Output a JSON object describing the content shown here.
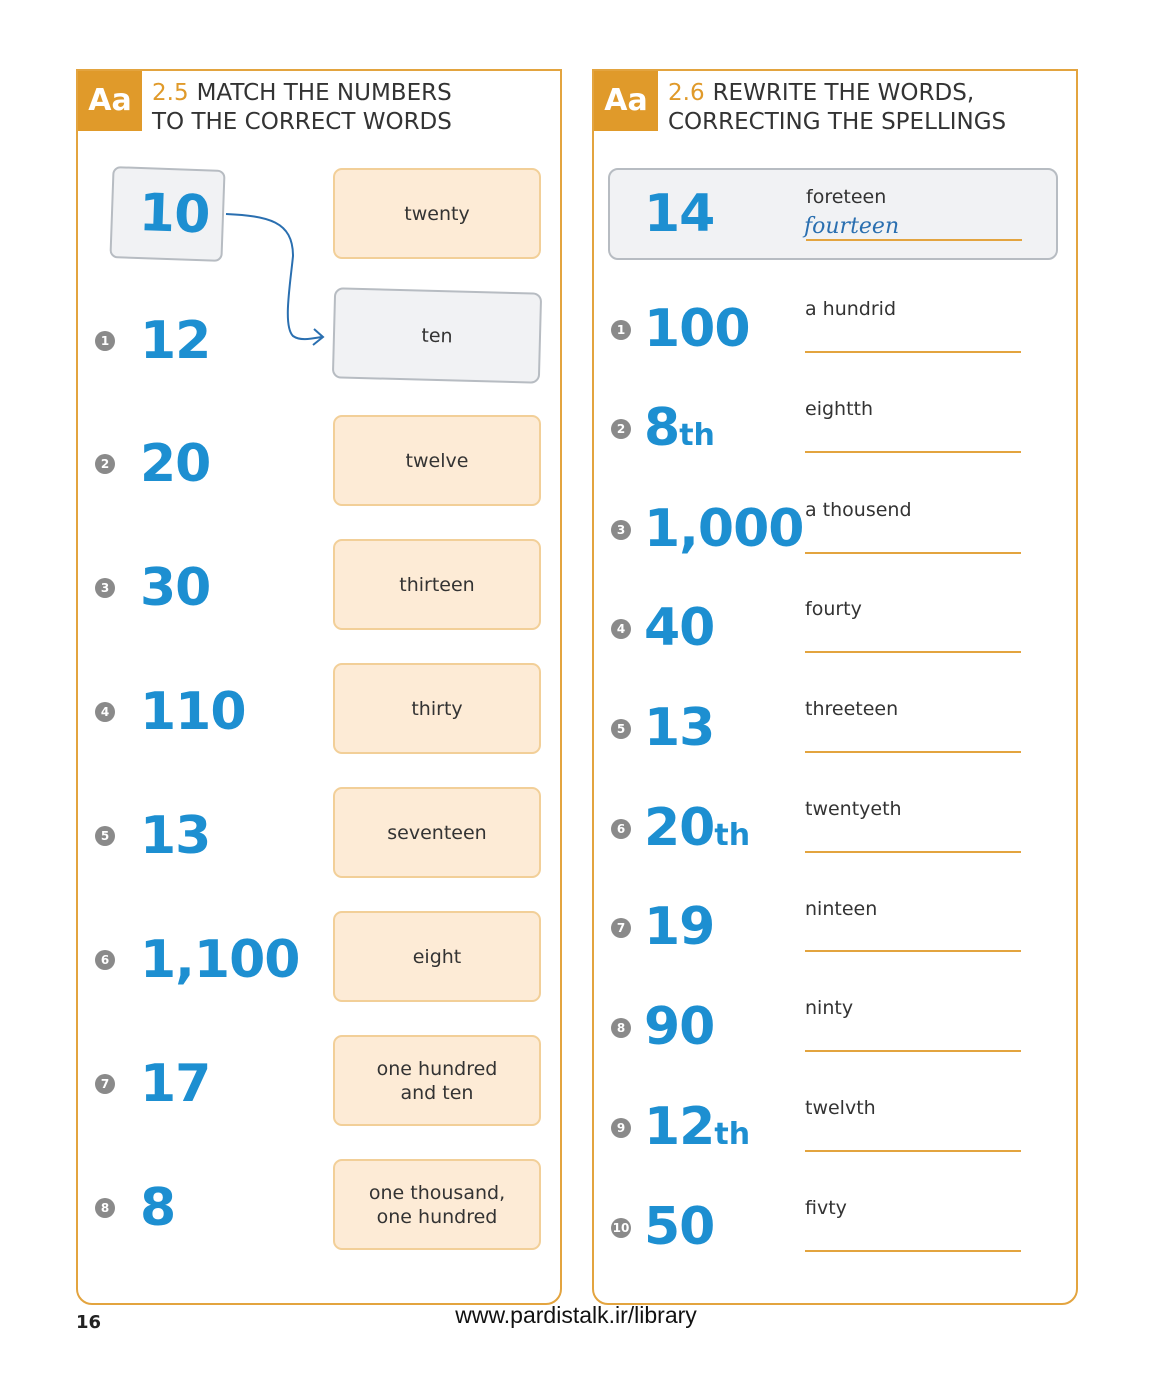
{
  "left": {
    "icon_label": "Aa",
    "exercise_number": "2.5",
    "title_line1": "MATCH THE NUMBERS",
    "title_line2": "TO THE CORRECT WORDS",
    "example": {
      "number": "10",
      "word": "ten"
    },
    "items": [
      {
        "marker": "1",
        "number": "12"
      },
      {
        "marker": "2",
        "number": "20"
      },
      {
        "marker": "3",
        "number": "30"
      },
      {
        "marker": "4",
        "number": "110"
      },
      {
        "marker": "5",
        "number": "13"
      },
      {
        "marker": "6",
        "number": "1,100"
      },
      {
        "marker": "7",
        "number": "17"
      },
      {
        "marker": "8",
        "number": "8"
      }
    ],
    "words": [
      "twenty",
      "ten",
      "twelve",
      "thirteen",
      "thirty",
      "seventeen",
      "eight",
      "one hundred\nand ten",
      "one thousand,\none hundred"
    ]
  },
  "right": {
    "icon_label": "Aa",
    "exercise_number": "2.6",
    "title_line1": "REWRITE THE WORDS,",
    "title_line2": "CORRECTING THE SPELLINGS",
    "example": {
      "number": "14",
      "misspelled": "foreteen",
      "answer": "fourteen"
    },
    "items": [
      {
        "marker": "1",
        "number": "100",
        "suffix": "",
        "misspelled": "a hundrid"
      },
      {
        "marker": "2",
        "number": "8",
        "suffix": "th",
        "misspelled": "eightth"
      },
      {
        "marker": "3",
        "number": "1,000",
        "suffix": "",
        "misspelled": "a thousend"
      },
      {
        "marker": "4",
        "number": "40",
        "suffix": "",
        "misspelled": "fourty"
      },
      {
        "marker": "5",
        "number": "13",
        "suffix": "",
        "misspelled": "threeteen"
      },
      {
        "marker": "6",
        "number": "20",
        "suffix": "th",
        "misspelled": "twentyeth"
      },
      {
        "marker": "7",
        "number": "19",
        "suffix": "",
        "misspelled": "ninteen"
      },
      {
        "marker": "8",
        "number": "90",
        "suffix": "",
        "misspelled": "ninty"
      },
      {
        "marker": "9",
        "number": "12",
        "suffix": "th",
        "misspelled": "twelvth"
      },
      {
        "marker": "10",
        "number": "50",
        "suffix": "",
        "misspelled": "fivty"
      }
    ]
  },
  "footer": {
    "page_number": "16",
    "url": "www.pardistalk.ir/library"
  },
  "colors": {
    "accent_orange": "#e09a2a",
    "number_blue": "#1d8fd1",
    "card_fill": "#fdebd6",
    "example_grey": "#f1f2f4"
  }
}
